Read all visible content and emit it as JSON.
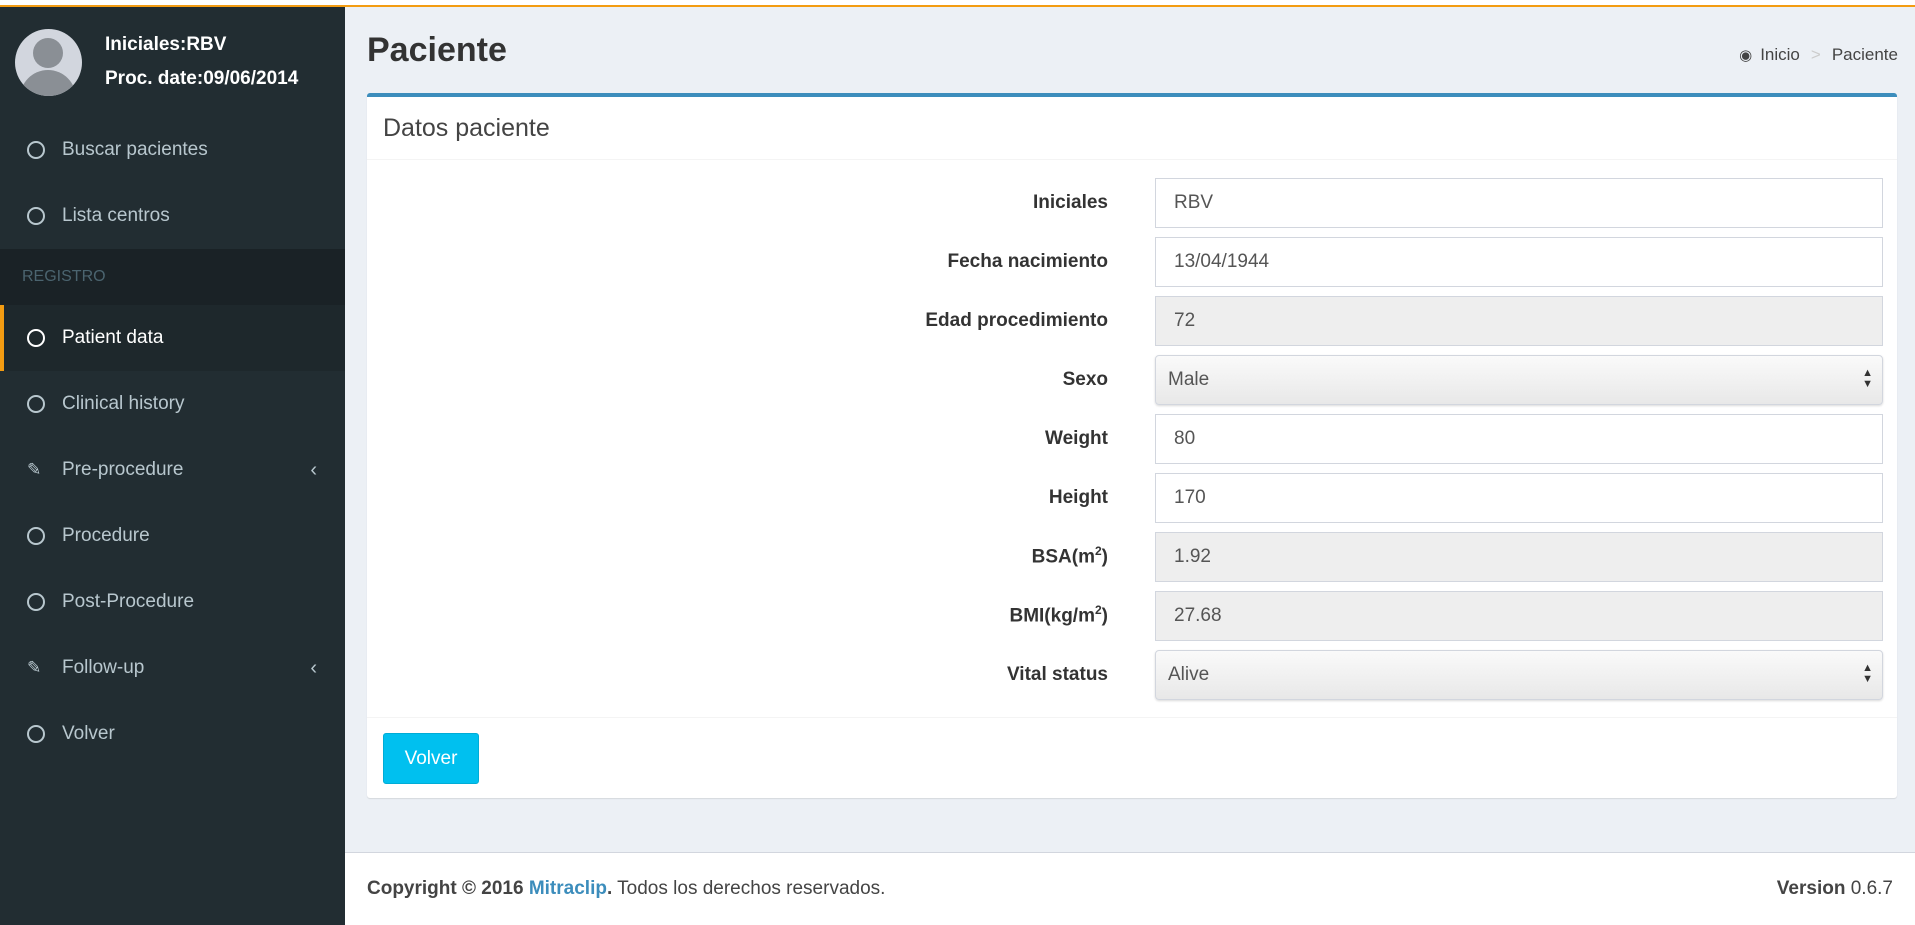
{
  "user": {
    "initials_line": "Iniciales:RBV",
    "proc_date_line": "Proc. date:09/06/2014"
  },
  "sidebar": {
    "items_top": [
      {
        "label": "Buscar pacientes",
        "icon": "circle-icon"
      },
      {
        "label": "Lista centros",
        "icon": "circle-icon"
      }
    ],
    "header": "REGISTRO",
    "items_registro": [
      {
        "label": "Patient data",
        "icon": "circle-icon",
        "active": true
      },
      {
        "label": "Clinical history",
        "icon": "circle-icon"
      },
      {
        "label": "Pre-procedure",
        "icon": "edit-icon",
        "chevron": "‹"
      },
      {
        "label": "Procedure",
        "icon": "circle-icon"
      },
      {
        "label": "Post-Procedure",
        "icon": "circle-icon"
      },
      {
        "label": "Follow-up",
        "icon": "edit-icon",
        "chevron": "‹"
      },
      {
        "label": "Volver",
        "icon": "circle-icon"
      }
    ]
  },
  "header": {
    "title": "Paciente",
    "breadcrumb_home": "Inicio",
    "breadcrumb_current": "Paciente",
    "breadcrumb_sep": ">"
  },
  "box": {
    "title": "Datos paciente",
    "fields": {
      "iniciales": {
        "label": "Iniciales",
        "value": "RBV"
      },
      "fecha_nacimiento": {
        "label": "Fecha nacimiento",
        "value": "13/04/1944"
      },
      "edad": {
        "label": "Edad procedimiento",
        "value": "72"
      },
      "sexo": {
        "label": "Sexo",
        "value": "Male"
      },
      "weight": {
        "label": "Weight",
        "value": "80"
      },
      "height": {
        "label": "Height",
        "value": "170"
      },
      "bsa": {
        "label_prefix": "BSA(m",
        "label_sup": "2",
        "label_suffix": ")",
        "value": "1.92"
      },
      "bmi": {
        "label_prefix": "BMI(kg/m",
        "label_sup": "2",
        "label_suffix": ")",
        "value": "27.68"
      },
      "vital": {
        "label": "Vital status",
        "value": "Alive"
      }
    },
    "back_button": "Volver"
  },
  "footer": {
    "copyright": "Copyright © 2016",
    "brand": "Mitraclip",
    "rights": "Todos los derechos reservados.",
    "version_label": "Version",
    "version_value": "0.6.7"
  },
  "colors": {
    "sidebar_bg": "#222d32",
    "accent_orange": "#f39c12",
    "box_top": "#3c8dbc",
    "button": "#00c0ef"
  }
}
